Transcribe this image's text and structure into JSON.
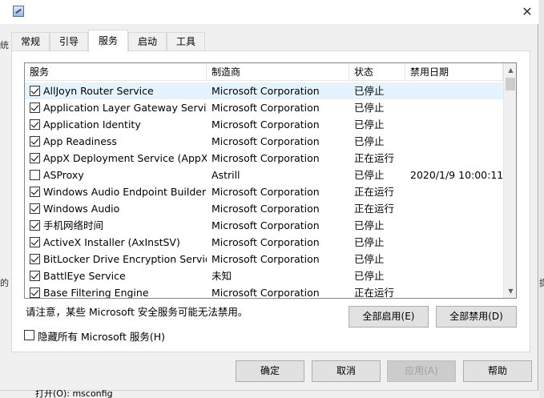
{
  "window": {
    "close_glyph": "✕",
    "left_edge_fragments": [
      "统",
      "的"
    ],
    "right_edge_fragment": "提"
  },
  "tabs": [
    "常规",
    "引导",
    "服务",
    "启动",
    "工具"
  ],
  "active_tab": "服务",
  "columns": [
    "服务",
    "制造商",
    "状态",
    "禁用日期"
  ],
  "services": [
    {
      "checked": true,
      "name": "AllJoyn Router Service",
      "maker": "Microsoft Corporation",
      "status": "已停止",
      "date": ""
    },
    {
      "checked": true,
      "name": "Application Layer Gateway Service",
      "maker": "Microsoft Corporation",
      "status": "已停止",
      "date": ""
    },
    {
      "checked": true,
      "name": "Application Identity",
      "maker": "Microsoft Corporation",
      "status": "已停止",
      "date": ""
    },
    {
      "checked": true,
      "name": "App Readiness",
      "maker": "Microsoft Corporation",
      "status": "已停止",
      "date": ""
    },
    {
      "checked": true,
      "name": "AppX Deployment Service (AppX...",
      "maker": "Microsoft Corporation",
      "status": "正在运行",
      "date": ""
    },
    {
      "checked": false,
      "name": "ASProxy",
      "maker": "Astrill",
      "status": "已停止",
      "date": "2020/1/9 10:00:11"
    },
    {
      "checked": true,
      "name": "Windows Audio Endpoint Builder",
      "maker": "Microsoft Corporation",
      "status": "正在运行",
      "date": ""
    },
    {
      "checked": true,
      "name": "Windows Audio",
      "maker": "Microsoft Corporation",
      "status": "正在运行",
      "date": ""
    },
    {
      "checked": true,
      "name": "手机网络时间",
      "maker": "Microsoft Corporation",
      "status": "已停止",
      "date": ""
    },
    {
      "checked": true,
      "name": "ActiveX Installer (AxInstSV)",
      "maker": "Microsoft Corporation",
      "status": "已停止",
      "date": ""
    },
    {
      "checked": true,
      "name": "BitLocker Drive Encryption Service",
      "maker": "Microsoft Corporation",
      "status": "已停止",
      "date": ""
    },
    {
      "checked": true,
      "name": "BattlEye Service",
      "maker": "未知",
      "status": "已停止",
      "date": ""
    },
    {
      "checked": true,
      "name": "Base Filtering Engine",
      "maker": "Microsoft Corporation",
      "status": "正在运行",
      "date": ""
    }
  ],
  "scroll": {
    "up": "▲",
    "down": "▼"
  },
  "note": "请注意，某些 Microsoft 安全服务可能无法禁用。",
  "enable_all": "全部启用(E)",
  "disable_all": "全部禁用(D)",
  "hide_ms_label": "隐藏所有 Microsoft 服务(H)",
  "hide_ms_checked": false,
  "footer": {
    "ok": "确定",
    "cancel": "取消",
    "apply": "应用(A)",
    "help": "帮助"
  },
  "background_text": "打开(O):   msconfig"
}
